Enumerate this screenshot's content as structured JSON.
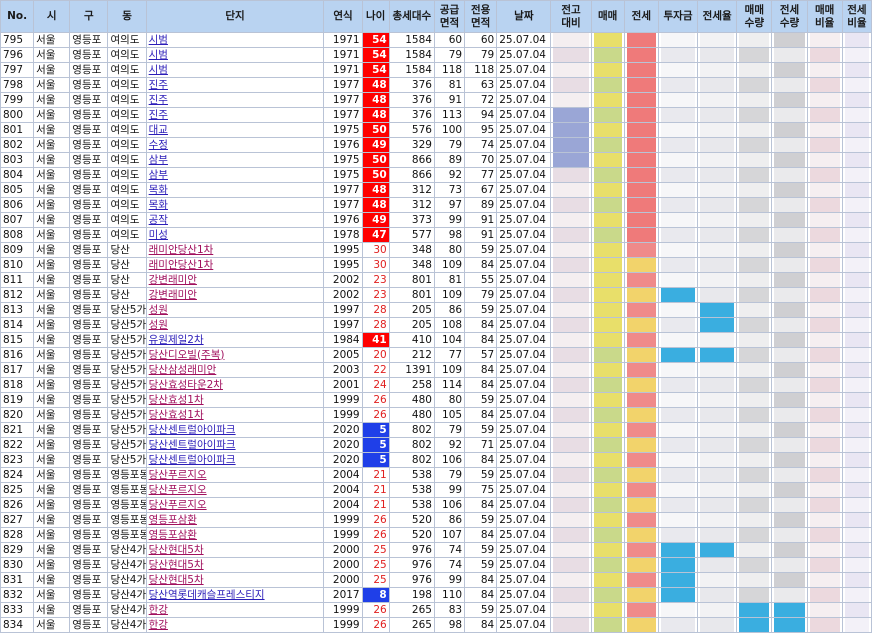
{
  "headers": {
    "no": "No.",
    "si": "시",
    "gu": "구",
    "dong": "동",
    "danji": "단지",
    "year": "연식",
    "age": "나이",
    "households": "총세대수",
    "supply_area": "공급\n면적",
    "exclusive_area": "전용\n면적",
    "date": "날짜",
    "vs_high": "전고\n대비",
    "sale": "매매",
    "jeonse": "전세",
    "invest": "투자금",
    "jeonse_rate": "전세율",
    "sale_count": "매매\n수량",
    "jeonse_count": "전세\n수량",
    "sale_ratio": "매매\n비율",
    "jeonse_ratio": "전세\n비율"
  },
  "colors": {
    "header_bg": "#b9d3f1",
    "age_header_bg": "#ff9b9b",
    "age_hot": "#ff0000",
    "age_new": "#1f3fe8",
    "link": "#2b1db8"
  },
  "rows": [
    {
      "no": "795",
      "si": "서울",
      "gu": "영등포",
      "dong": "여의도",
      "danji": "시범",
      "year": "1971",
      "age": "54",
      "households": "1584",
      "supply": "60",
      "exclusive": "60",
      "date": "25.07.04"
    },
    {
      "no": "796",
      "si": "서울",
      "gu": "영등포",
      "dong": "여의도",
      "danji": "시범",
      "year": "1971",
      "age": "54",
      "households": "1584",
      "supply": "79",
      "exclusive": "79",
      "date": "25.07.04"
    },
    {
      "no": "797",
      "si": "서울",
      "gu": "영등포",
      "dong": "여의도",
      "danji": "시범",
      "year": "1971",
      "age": "54",
      "households": "1584",
      "supply": "118",
      "exclusive": "118",
      "date": "25.07.04"
    },
    {
      "no": "798",
      "si": "서울",
      "gu": "영등포",
      "dong": "여의도",
      "danji": "진주",
      "year": "1977",
      "age": "48",
      "households": "376",
      "supply": "81",
      "exclusive": "63",
      "date": "25.07.04"
    },
    {
      "no": "799",
      "si": "서울",
      "gu": "영등포",
      "dong": "여의도",
      "danji": "진주",
      "year": "1977",
      "age": "48",
      "households": "376",
      "supply": "91",
      "exclusive": "72",
      "date": "25.07.04"
    },
    {
      "no": "800",
      "si": "서울",
      "gu": "영등포",
      "dong": "여의도",
      "danji": "진주",
      "year": "1977",
      "age": "48",
      "households": "376",
      "supply": "113",
      "exclusive": "94",
      "date": "25.07.04"
    },
    {
      "no": "801",
      "si": "서울",
      "gu": "영등포",
      "dong": "여의도",
      "danji": "대교",
      "year": "1975",
      "age": "50",
      "households": "576",
      "supply": "100",
      "exclusive": "95",
      "date": "25.07.04"
    },
    {
      "no": "802",
      "si": "서울",
      "gu": "영등포",
      "dong": "여의도",
      "danji": "수정",
      "year": "1976",
      "age": "49",
      "households": "329",
      "supply": "79",
      "exclusive": "74",
      "date": "25.07.04"
    },
    {
      "no": "803",
      "si": "서울",
      "gu": "영등포",
      "dong": "여의도",
      "danji": "삼부",
      "year": "1975",
      "age": "50",
      "households": "866",
      "supply": "89",
      "exclusive": "70",
      "date": "25.07.04"
    },
    {
      "no": "804",
      "si": "서울",
      "gu": "영등포",
      "dong": "여의도",
      "danji": "삼부",
      "year": "1975",
      "age": "50",
      "households": "866",
      "supply": "92",
      "exclusive": "77",
      "date": "25.07.04"
    },
    {
      "no": "805",
      "si": "서울",
      "gu": "영등포",
      "dong": "여의도",
      "danji": "목화",
      "year": "1977",
      "age": "48",
      "households": "312",
      "supply": "73",
      "exclusive": "67",
      "date": "25.07.04"
    },
    {
      "no": "806",
      "si": "서울",
      "gu": "영등포",
      "dong": "여의도",
      "danji": "목화",
      "year": "1977",
      "age": "48",
      "households": "312",
      "supply": "97",
      "exclusive": "89",
      "date": "25.07.04"
    },
    {
      "no": "807",
      "si": "서울",
      "gu": "영등포",
      "dong": "여의도",
      "danji": "공작",
      "year": "1976",
      "age": "49",
      "households": "373",
      "supply": "99",
      "exclusive": "91",
      "date": "25.07.04"
    },
    {
      "no": "808",
      "si": "서울",
      "gu": "영등포",
      "dong": "여의도",
      "danji": "미성",
      "year": "1978",
      "age": "47",
      "households": "577",
      "supply": "98",
      "exclusive": "91",
      "date": "25.07.04"
    },
    {
      "no": "809",
      "si": "서울",
      "gu": "영등포",
      "dong": "당산",
      "danji": "래미안당산1차",
      "year": "1995",
      "age": "30",
      "households": "348",
      "supply": "80",
      "exclusive": "59",
      "date": "25.07.04"
    },
    {
      "no": "810",
      "si": "서울",
      "gu": "영등포",
      "dong": "당산",
      "danji": "래미안당산1차",
      "year": "1995",
      "age": "30",
      "households": "348",
      "supply": "109",
      "exclusive": "84",
      "date": "25.07.04"
    },
    {
      "no": "811",
      "si": "서울",
      "gu": "영등포",
      "dong": "당산",
      "danji": "강변래미안",
      "year": "2002",
      "age": "23",
      "households": "801",
      "supply": "81",
      "exclusive": "55",
      "date": "25.07.04"
    },
    {
      "no": "812",
      "si": "서울",
      "gu": "영등포",
      "dong": "당산",
      "danji": "강변래미안",
      "year": "2002",
      "age": "23",
      "households": "801",
      "supply": "109",
      "exclusive": "79",
      "date": "25.07.04"
    },
    {
      "no": "813",
      "si": "서울",
      "gu": "영등포",
      "dong": "당산5가",
      "danji": "성원",
      "year": "1997",
      "age": "28",
      "households": "205",
      "supply": "86",
      "exclusive": "59",
      "date": "25.07.04"
    },
    {
      "no": "814",
      "si": "서울",
      "gu": "영등포",
      "dong": "당산5가",
      "danji": "성원",
      "year": "1997",
      "age": "28",
      "households": "205",
      "supply": "108",
      "exclusive": "84",
      "date": "25.07.04"
    },
    {
      "no": "815",
      "si": "서울",
      "gu": "영등포",
      "dong": "당산5가",
      "danji": "유원제일2차",
      "year": "1984",
      "age": "41",
      "households": "410",
      "supply": "104",
      "exclusive": "84",
      "date": "25.07.04"
    },
    {
      "no": "816",
      "si": "서울",
      "gu": "영등포",
      "dong": "당산5가",
      "danji": "당산디오빌(주복)",
      "year": "2005",
      "age": "20",
      "households": "212",
      "supply": "77",
      "exclusive": "57",
      "date": "25.07.04"
    },
    {
      "no": "817",
      "si": "서울",
      "gu": "영등포",
      "dong": "당산5가",
      "danji": "당산삼성래미안",
      "year": "2003",
      "age": "22",
      "households": "1391",
      "supply": "109",
      "exclusive": "84",
      "date": "25.07.04"
    },
    {
      "no": "818",
      "si": "서울",
      "gu": "영등포",
      "dong": "당산5가",
      "danji": "당산효성타운2차",
      "year": "2001",
      "age": "24",
      "households": "258",
      "supply": "114",
      "exclusive": "84",
      "date": "25.07.04"
    },
    {
      "no": "819",
      "si": "서울",
      "gu": "영등포",
      "dong": "당산5가",
      "danji": "당산효성1차",
      "year": "1999",
      "age": "26",
      "households": "480",
      "supply": "80",
      "exclusive": "59",
      "date": "25.07.04"
    },
    {
      "no": "820",
      "si": "서울",
      "gu": "영등포",
      "dong": "당산5가",
      "danji": "당산효성1차",
      "year": "1999",
      "age": "26",
      "households": "480",
      "supply": "105",
      "exclusive": "84",
      "date": "25.07.04"
    },
    {
      "no": "821",
      "si": "서울",
      "gu": "영등포",
      "dong": "당산5가",
      "danji": "당산센트럴아이파크",
      "year": "2020",
      "age": "5",
      "households": "802",
      "supply": "79",
      "exclusive": "59",
      "date": "25.07.04"
    },
    {
      "no": "822",
      "si": "서울",
      "gu": "영등포",
      "dong": "당산5가",
      "danji": "당산센트럴아이파크",
      "year": "2020",
      "age": "5",
      "households": "802",
      "supply": "92",
      "exclusive": "71",
      "date": "25.07.04"
    },
    {
      "no": "823",
      "si": "서울",
      "gu": "영등포",
      "dong": "당산5가",
      "danji": "당산센트럴아이파크",
      "year": "2020",
      "age": "5",
      "households": "802",
      "supply": "106",
      "exclusive": "84",
      "date": "25.07.04"
    },
    {
      "no": "824",
      "si": "서울",
      "gu": "영등포",
      "dong": "영등포동",
      "danji": "당산푸르지오",
      "year": "2004",
      "age": "21",
      "households": "538",
      "supply": "79",
      "exclusive": "59",
      "date": "25.07.04"
    },
    {
      "no": "825",
      "si": "서울",
      "gu": "영등포",
      "dong": "영등포동",
      "danji": "당산푸르지오",
      "year": "2004",
      "age": "21",
      "households": "538",
      "supply": "99",
      "exclusive": "75",
      "date": "25.07.04"
    },
    {
      "no": "826",
      "si": "서울",
      "gu": "영등포",
      "dong": "영등포동",
      "danji": "당산푸르지오",
      "year": "2004",
      "age": "21",
      "households": "538",
      "supply": "106",
      "exclusive": "84",
      "date": "25.07.04"
    },
    {
      "no": "827",
      "si": "서울",
      "gu": "영등포",
      "dong": "영등포동",
      "danji": "영등포삼환",
      "year": "1999",
      "age": "26",
      "households": "520",
      "supply": "86",
      "exclusive": "59",
      "date": "25.07.04"
    },
    {
      "no": "828",
      "si": "서울",
      "gu": "영등포",
      "dong": "영등포동",
      "danji": "영등포삼환",
      "year": "1999",
      "age": "26",
      "households": "520",
      "supply": "107",
      "exclusive": "84",
      "date": "25.07.04"
    },
    {
      "no": "829",
      "si": "서울",
      "gu": "영등포",
      "dong": "당산4가",
      "danji": "당산현대5차",
      "year": "2000",
      "age": "25",
      "households": "976",
      "supply": "74",
      "exclusive": "59",
      "date": "25.07.04"
    },
    {
      "no": "830",
      "si": "서울",
      "gu": "영등포",
      "dong": "당산4가",
      "danji": "당산현대5차",
      "year": "2000",
      "age": "25",
      "households": "976",
      "supply": "74",
      "exclusive": "59",
      "date": "25.07.04"
    },
    {
      "no": "831",
      "si": "서울",
      "gu": "영등포",
      "dong": "당산4가",
      "danji": "당산현대5차",
      "year": "2000",
      "age": "25",
      "households": "976",
      "supply": "99",
      "exclusive": "84",
      "date": "25.07.04"
    },
    {
      "no": "832",
      "si": "서울",
      "gu": "영등포",
      "dong": "당산4가",
      "danji": "당산역롯데캐슬프레스티지",
      "year": "2017",
      "age": "8",
      "households": "198",
      "supply": "110",
      "exclusive": "84",
      "date": "25.07.04"
    },
    {
      "no": "833",
      "si": "서울",
      "gu": "영등포",
      "dong": "당산4가",
      "danji": "한강",
      "year": "1999",
      "age": "26",
      "households": "265",
      "supply": "83",
      "exclusive": "59",
      "date": "25.07.04"
    },
    {
      "no": "834",
      "si": "서울",
      "gu": "영등포",
      "dong": "당산4가",
      "danji": "한강",
      "year": "1999",
      "age": "26",
      "households": "265",
      "supply": "98",
      "exclusive": "84",
      "date": "25.07.04"
    }
  ]
}
